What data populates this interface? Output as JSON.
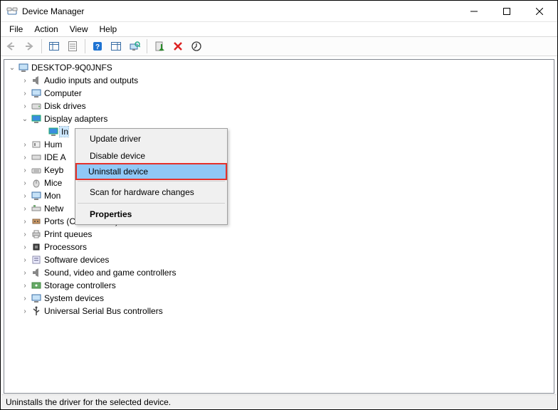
{
  "window": {
    "title": "Device Manager"
  },
  "menubar": {
    "items": [
      "File",
      "Action",
      "View",
      "Help"
    ]
  },
  "tree": {
    "root": "DESKTOP-9Q0JNFS",
    "categories": [
      {
        "label": "Audio inputs and outputs",
        "expanded": false
      },
      {
        "label": "Computer",
        "expanded": false
      },
      {
        "label": "Disk drives",
        "expanded": false
      },
      {
        "label": "Display adapters",
        "expanded": true,
        "children": [
          {
            "label": "In",
            "selected": true
          }
        ]
      },
      {
        "label": "Hum",
        "expanded": false
      },
      {
        "label": "IDE A",
        "expanded": false
      },
      {
        "label": "Keyb",
        "expanded": false
      },
      {
        "label": "Mice",
        "expanded": false
      },
      {
        "label": "Mon",
        "expanded": false
      },
      {
        "label": "Netw",
        "expanded": false
      },
      {
        "label": "Ports (COM & LPT)",
        "expanded": false
      },
      {
        "label": "Print queues",
        "expanded": false
      },
      {
        "label": "Processors",
        "expanded": false
      },
      {
        "label": "Software devices",
        "expanded": false
      },
      {
        "label": "Sound, video and game controllers",
        "expanded": false
      },
      {
        "label": "Storage controllers",
        "expanded": false
      },
      {
        "label": "System devices",
        "expanded": false
      },
      {
        "label": "Universal Serial Bus controllers",
        "expanded": false
      }
    ]
  },
  "context_menu": {
    "items": [
      {
        "label": "Update driver",
        "type": "item"
      },
      {
        "label": "Disable device",
        "type": "item"
      },
      {
        "label": "Uninstall device",
        "type": "item",
        "highlight": true
      },
      {
        "type": "separator"
      },
      {
        "label": "Scan for hardware changes",
        "type": "item"
      },
      {
        "type": "separator"
      },
      {
        "label": "Properties",
        "type": "item",
        "bold": true
      }
    ]
  },
  "statusbar": {
    "text": "Uninstalls the driver for the selected device."
  }
}
